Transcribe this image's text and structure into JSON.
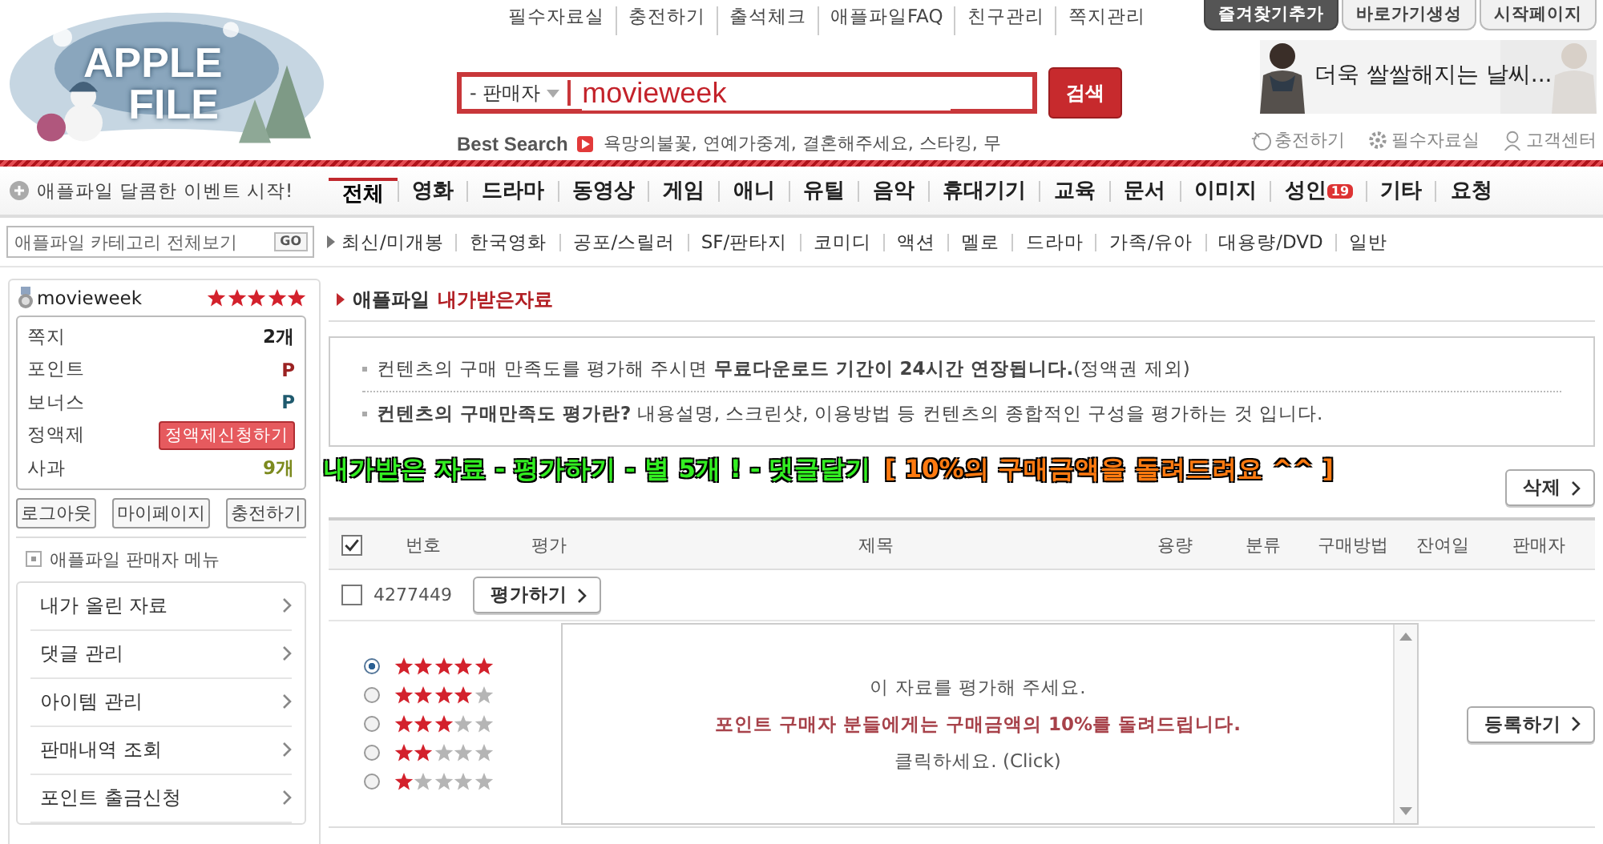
{
  "logo": {
    "line1": "APPLE",
    "line2": "FILE"
  },
  "top_links": [
    "필수자료실",
    "충전하기",
    "출석체크",
    "애플파일FAQ",
    "친구관리",
    "쪽지관리"
  ],
  "top_tabs": [
    {
      "label": "즐겨찾기추가",
      "selected": true
    },
    {
      "label": "바로가기생성",
      "selected": false
    },
    {
      "label": "시작페이지",
      "selected": false
    }
  ],
  "search": {
    "scope": "- 판매자",
    "value": "movieweek",
    "button": "검색"
  },
  "best_search": {
    "label": "Best Search",
    "terms": "욕망의불꽃, 연예가중계, 결혼해주세요, 스타킹, 무"
  },
  "banner": {
    "kind": "picture",
    "text": "더욱 쌀쌀해지는 날씨..."
  },
  "util_links": [
    {
      "label": "충전하기",
      "kind": "coin"
    },
    {
      "label": "필수자료실",
      "kind": "gear"
    },
    {
      "label": "고객센터",
      "kind": "person"
    }
  ],
  "event": {
    "text": "애플파일 달콤한 이벤트 시작!"
  },
  "nav": [
    {
      "label": "전체",
      "selected": true
    },
    {
      "label": "영화",
      "selected": false
    },
    {
      "label": "드라마",
      "selected": false
    },
    {
      "label": "동영상",
      "selected": false
    },
    {
      "label": "게임",
      "selected": false
    },
    {
      "label": "애니",
      "selected": false
    },
    {
      "label": "유틸",
      "selected": false
    },
    {
      "label": "음악",
      "selected": false
    },
    {
      "label": "휴대기기",
      "selected": false
    },
    {
      "label": "교육",
      "selected": false
    },
    {
      "label": "문서",
      "selected": false
    },
    {
      "label": "이미지",
      "selected": false
    },
    {
      "label": "성인",
      "selected": false,
      "badge": "19"
    },
    {
      "label": "기타",
      "selected": false
    },
    {
      "label": "요청",
      "selected": false
    }
  ],
  "category_field": {
    "placeholder": "애플파일 카테고리 전체보기",
    "button": "GO"
  },
  "subnav": [
    "최신/미개봉",
    "한국영화",
    "공포/스릴러",
    "SF/판타지",
    "코미디",
    "액션",
    "멜로",
    "드라마",
    "가족/유아",
    "대용량/DVD",
    "일반"
  ],
  "user": {
    "name": "movieweek",
    "stars": 5,
    "rows": [
      {
        "label": "쪽지",
        "kind": "value",
        "value": "2개",
        "color": "#222222"
      },
      {
        "label": "포인트",
        "kind": "value",
        "value": "P",
        "color": "#9b2222"
      },
      {
        "label": "보너스",
        "kind": "value",
        "value": "P",
        "color": "#1f5a6e"
      },
      {
        "label": "정액제",
        "kind": "button",
        "value": "정액제신청하기"
      },
      {
        "label": "사과",
        "kind": "value",
        "value": "9개",
        "color": "#7c8a1e"
      }
    ],
    "buttons": [
      "로그아웃",
      "마이페이지",
      "충전하기"
    ]
  },
  "seller_menu": {
    "title": "애플파일 판매자 메뉴",
    "items": [
      "내가 올린 자료",
      "댓글 관리",
      "아이템 관리",
      "판매내역 조회",
      "포인트 출금신청"
    ]
  },
  "page_title": {
    "prefix": "애플파일",
    "title": "내가받은자료"
  },
  "info": [
    "컨텐츠의 구매 만족도를 평가해 주시면 **무료다운로드 기간이 24시간 연장됩니다.**(정액권 제외)",
    "**컨텐츠의 구매만족도 평가란?** 내용설명, 스크린샷, 이용방법 등 컨텐츠의 종합적인 구성을 평가하는 것 입니다."
  ],
  "promo": [
    {
      "text": "내가받은 자료 - 평가하기 - 별 5개 ! - 댓글달기",
      "color": "#33ee22"
    },
    {
      "text": "[ 10%의 구매금액을 돌려드려요 ^^ ]",
      "color": "#ff7a10"
    }
  ],
  "delete_button": "삭제",
  "table": {
    "header_checked": true,
    "columns": [
      "번호",
      "평가",
      "제목",
      "용량",
      "분류",
      "구매방법",
      "잔여일",
      "판매자"
    ],
    "rows": [
      {
        "checked": false,
        "number": "4277449",
        "action": "평가하기"
      }
    ]
  },
  "rating": {
    "options": [
      {
        "stars": 5,
        "selected": true
      },
      {
        "stars": 4,
        "selected": false
      },
      {
        "stars": 3,
        "selected": false
      },
      {
        "stars": 2,
        "selected": false
      },
      {
        "stars": 1,
        "selected": false
      }
    ],
    "comment_lines": [
      {
        "kind": "plain",
        "text": "이 자료를 평가해 주세요."
      },
      {
        "kind": "emphasis",
        "text": "포인트 구매자 분들에게는 구매금액의 10%를 돌려드립니다."
      },
      {
        "kind": "plain",
        "text": "클릭하세요. (Click)"
      }
    ],
    "submit": "등록하기"
  }
}
